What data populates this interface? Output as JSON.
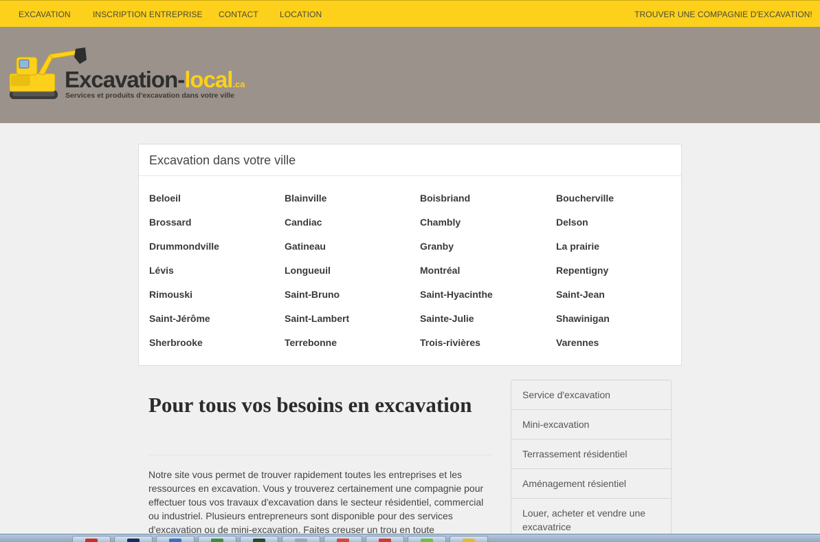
{
  "topnav": {
    "items": [
      "EXCAVATION",
      "INSCRIPTION ENTREPRISE",
      "CONTACT",
      "LOCATION"
    ],
    "cta": "TROUVER UNE COMPAGNIE D'EXCAVATION!"
  },
  "logo": {
    "word_main": "Excavation-",
    "word_highlight": "local",
    "word_suffix": ".ca",
    "tagline": "Services et produits d'excavation dans votre ville"
  },
  "cities_panel": {
    "title": "Excavation dans votre ville",
    "cities": [
      "Beloeil",
      "Blainville",
      "Boisbriand",
      "Boucherville",
      "Brossard",
      "Candiac",
      "Chambly",
      "Delson",
      "Drummondville",
      "Gatineau",
      "Granby",
      "La prairie",
      "Lévis",
      "Longueuil",
      "Montréal",
      "Repentigny",
      "Rimouski",
      "Saint-Bruno",
      "Saint-Hyacinthe",
      "Saint-Jean",
      "Saint-Jérôme",
      "Saint-Lambert",
      "Sainte-Julie",
      "Shawinigan",
      "Sherbrooke",
      "Terrebonne",
      "Trois-rivières",
      "Varennes"
    ]
  },
  "main": {
    "title": "Pour tous vos besoins en excavation",
    "paragraph": "Notre site vous permet de trouver rapidement toutes les entreprises et les ressources en excavation. Vous y trouverez certainement une compagnie pour effectuer tous vos travaux d'excavation dans le secteur résidentiel, commercial ou industriel. Plusieurs entrepreneurs sont disponible pour des services d'excavation ou de mini-excavation. Faites creuser un trou en toute"
  },
  "sidebar": {
    "items": [
      "Service d'excavation",
      "Mini-excavation",
      "Terrassement résidentiel",
      "Aménagement résientiel",
      "Louer, acheter et vendre une excavatrice"
    ]
  },
  "colors": {
    "accent_yellow": "#fdd01b",
    "header_taupe": "#9a928b",
    "background": "#f0f0f0"
  }
}
